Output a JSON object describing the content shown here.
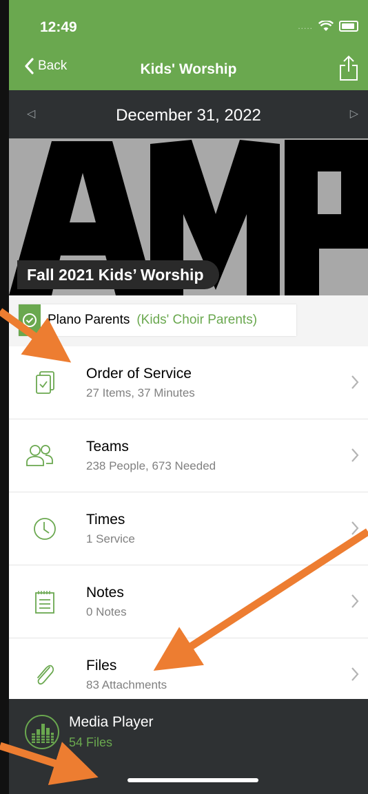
{
  "status_bar": {
    "time": "12:49",
    "signal": "....."
  },
  "nav": {
    "back_label": "Back",
    "title": "Kids' Worship"
  },
  "date_bar": {
    "date": "December 31, 2022",
    "prev_glyph": "◁",
    "next_glyph": "▷"
  },
  "banner": {
    "art_text": "AMP",
    "series_name": "Fall 2021 Kids’ Worship"
  },
  "team": {
    "name": "Plano Parents",
    "group": "(Kids' Choir Parents)"
  },
  "rows": [
    {
      "title": "Order of Service",
      "subtitle": "27 Items, 37 Minutes",
      "icon": "order-of-service-icon"
    },
    {
      "title": "Teams",
      "subtitle": "238 People, 673 Needed",
      "icon": "teams-icon"
    },
    {
      "title": "Times",
      "subtitle": "1 Service",
      "icon": "clock-icon"
    },
    {
      "title": "Notes",
      "subtitle": "0 Notes",
      "icon": "notes-icon"
    },
    {
      "title": "Files",
      "subtitle": "83 Attachments",
      "icon": "paperclip-icon"
    }
  ],
  "media_player": {
    "title": "Media Player",
    "subtitle": "54 Files"
  },
  "colors": {
    "accent": "#6aa84f",
    "dark_bar": "#2e3133",
    "annotation_arrow": "#ed7d31"
  }
}
